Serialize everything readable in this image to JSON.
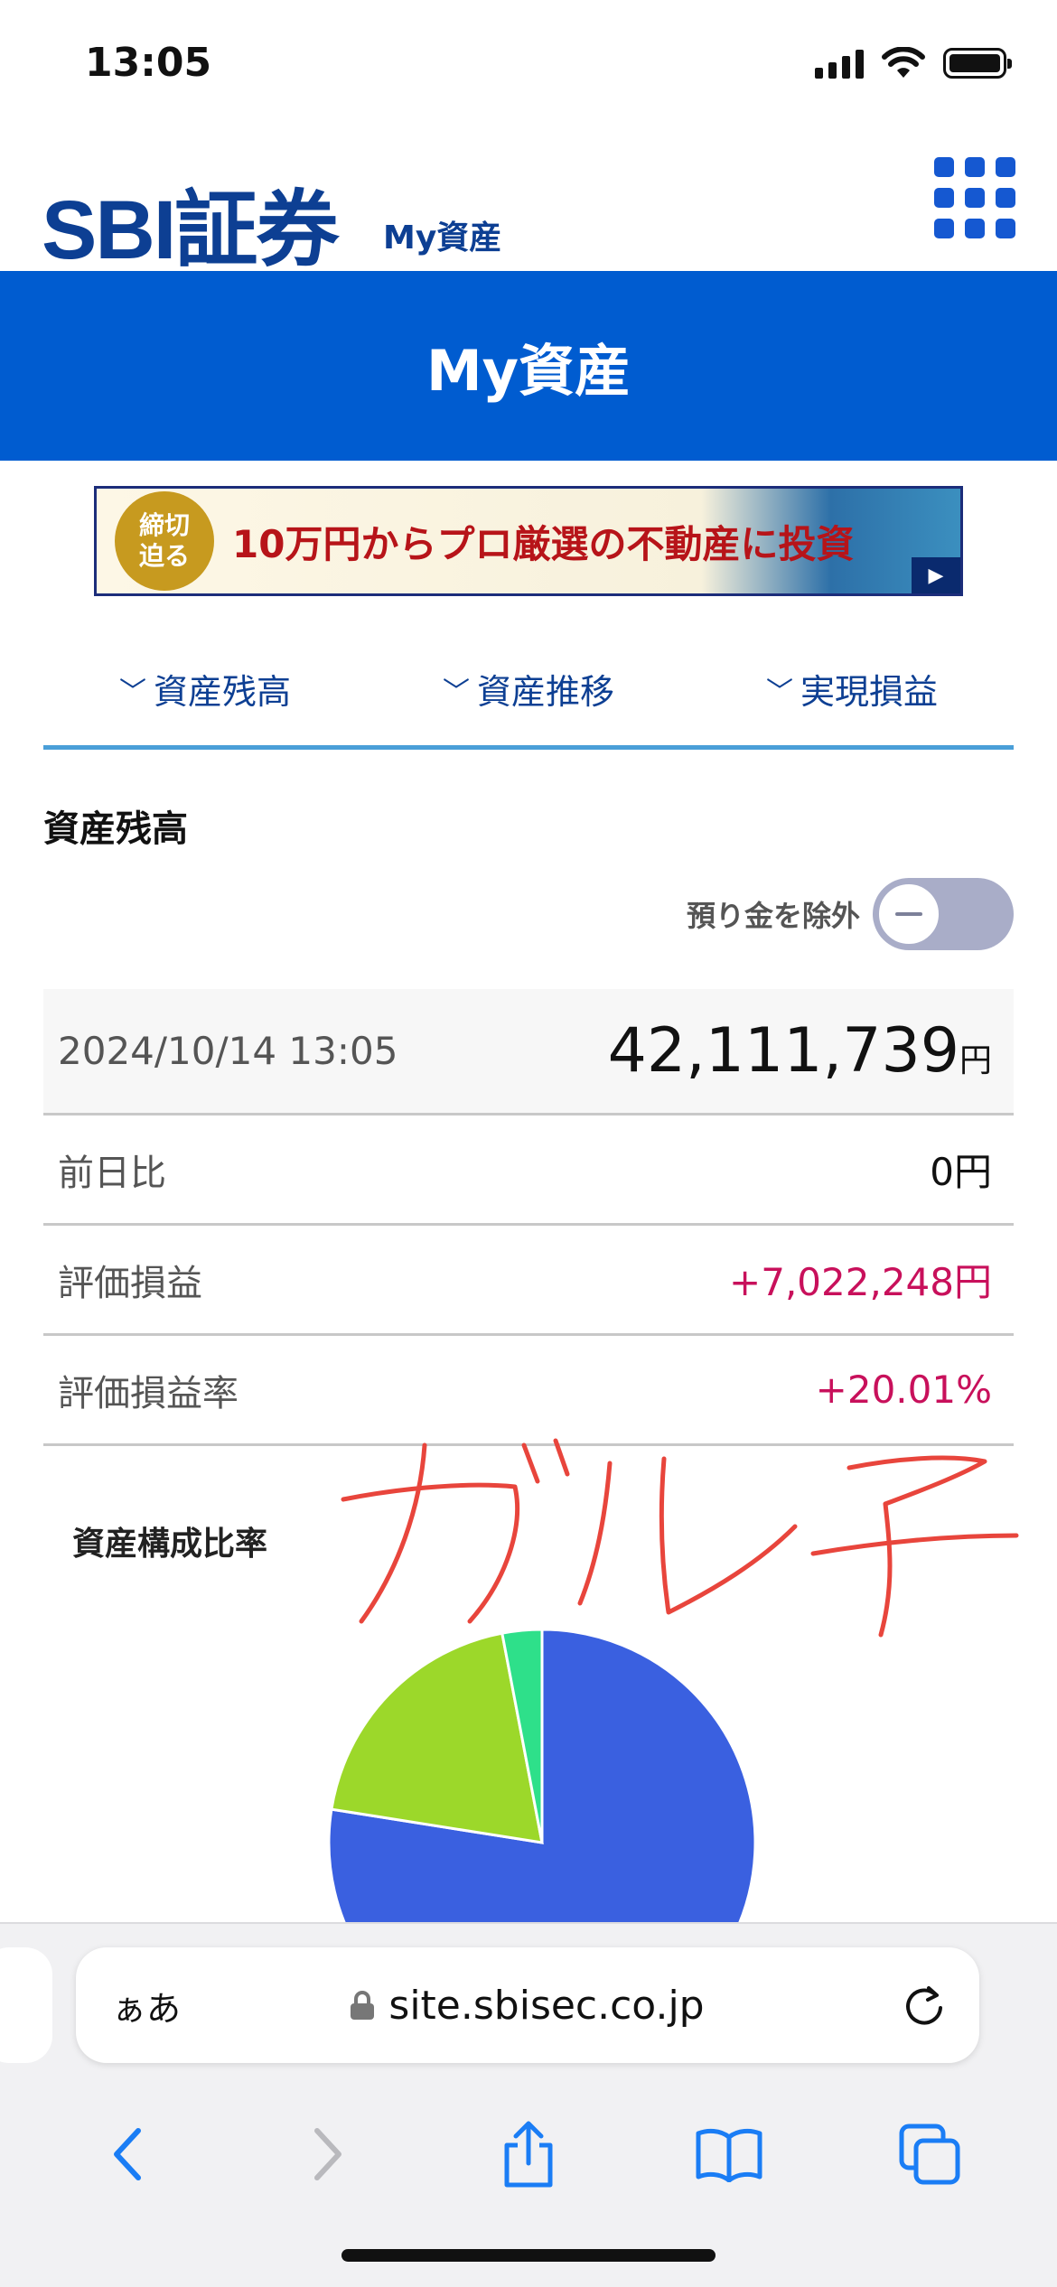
{
  "status_bar": {
    "time": "13:05"
  },
  "header": {
    "logo": "SBI証券",
    "logo_sub": "My資産"
  },
  "title_bar": {
    "title": "My資産"
  },
  "banner": {
    "badge": "締切\n迫る",
    "text": "10万円からプロ厳選の不動産に投資"
  },
  "anchor_nav": {
    "items": [
      {
        "label": "資産残高"
      },
      {
        "label": "資産推移"
      },
      {
        "label": "実現損益"
      }
    ]
  },
  "balance": {
    "section_title": "資産残高",
    "toggle_label": "預り金を除外",
    "toggle_on": false,
    "datetime": "2024/10/14 13:05",
    "total": "42,111,739",
    "yen": "円",
    "rows": [
      {
        "label": "前日比",
        "value": "0円",
        "positive": false
      },
      {
        "label": "評価損益",
        "value": "+7,022,248円",
        "positive": true
      },
      {
        "label": "評価損益率",
        "value": "+20.01%",
        "positive": true
      }
    ]
  },
  "composition": {
    "title": "資産構成比率",
    "handwriting": "ガルチ",
    "colors": {
      "slice1": "#3a60e0",
      "slice2": "#9cd82a",
      "slice3": "#2ee08a"
    }
  },
  "chart_data": {
    "type": "pie",
    "title": "資産構成比率",
    "values": [
      77.5,
      19.5,
      3.0
    ],
    "colors": [
      "#3a60e0",
      "#9cd82a",
      "#2ee08a"
    ]
  },
  "browser": {
    "aa_label": "ぁあ",
    "url": "site.sbisec.co.jp"
  }
}
